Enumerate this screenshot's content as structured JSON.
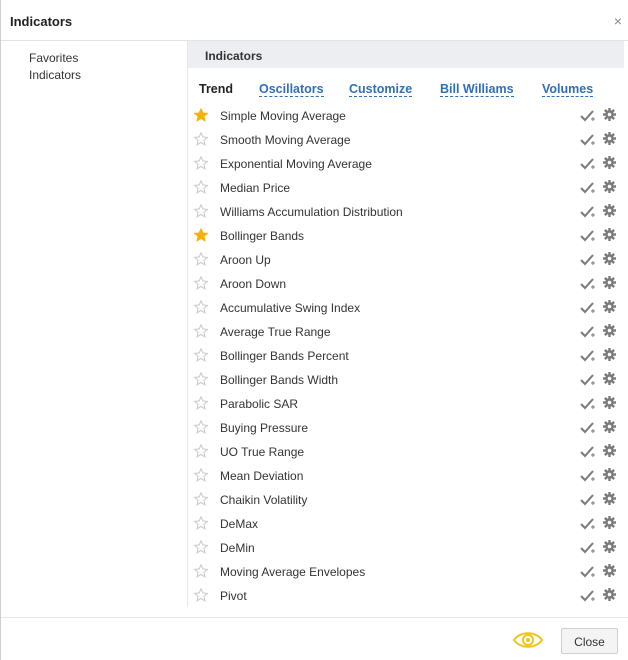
{
  "dialog": {
    "title": "Indicators",
    "close_glyph": "×"
  },
  "sidebar": {
    "items": [
      {
        "label": "Favorites"
      },
      {
        "label": "Indicators"
      }
    ]
  },
  "panel": {
    "header": "Indicators"
  },
  "tabs": [
    {
      "label": "Trend",
      "active": true
    },
    {
      "label": "Oscillators",
      "active": false
    },
    {
      "label": "Customize",
      "active": false
    },
    {
      "label": "Bill Williams",
      "active": false
    },
    {
      "label": "Volumes",
      "active": false
    }
  ],
  "indicators": [
    {
      "name": "Simple Moving Average",
      "favorite": true
    },
    {
      "name": "Smooth Moving Average",
      "favorite": false
    },
    {
      "name": "Exponential Moving Average",
      "favorite": false
    },
    {
      "name": "Median Price",
      "favorite": false
    },
    {
      "name": "Williams Accumulation Distribution",
      "favorite": false
    },
    {
      "name": "Bollinger Bands",
      "favorite": true
    },
    {
      "name": "Aroon Up",
      "favorite": false
    },
    {
      "name": "Aroon Down",
      "favorite": false
    },
    {
      "name": "Accumulative Swing Index",
      "favorite": false
    },
    {
      "name": "Average True Range",
      "favorite": false
    },
    {
      "name": "Bollinger Bands Percent",
      "favorite": false
    },
    {
      "name": "Bollinger Bands Width",
      "favorite": false
    },
    {
      "name": "Parabolic SAR",
      "favorite": false
    },
    {
      "name": "Buying Pressure",
      "favorite": false
    },
    {
      "name": "UO True Range",
      "favorite": false
    },
    {
      "name": "Mean Deviation",
      "favorite": false
    },
    {
      "name": "Chaikin Volatility",
      "favorite": false
    },
    {
      "name": "DeMax",
      "favorite": false
    },
    {
      "name": "DeMin",
      "favorite": false
    },
    {
      "name": "Moving Average Envelopes",
      "favorite": false
    },
    {
      "name": "Pivot",
      "favorite": false
    }
  ],
  "row_icons": {
    "star": "star-icon",
    "add": "add-check-icon",
    "settings": "gear-icon"
  },
  "footer": {
    "eye_icon": "eye-icon",
    "close_label": "Close"
  },
  "colors": {
    "star_active": "#f5b301",
    "star_inactive": "#c7c7c7",
    "link": "#2f6fb7",
    "icon": "#7a7a7a",
    "eye": "#f0c419"
  }
}
